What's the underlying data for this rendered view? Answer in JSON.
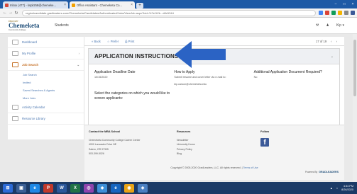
{
  "browser": {
    "tabs": [
      {
        "label": "Inbox (477) - kspitz58@chemeke...",
        "favicon_color": "#d44638"
      },
      {
        "label": "Office Assistant - Chemeketa Co...",
        "favicon_color": "#f2a100",
        "active": true
      }
    ],
    "new_tab": "+",
    "url": "regionlcandidate.gradleaders.com/Chemeketa/Candidates/Authenticated/Jobs/ViewJob.aspx?bid=%7e%2b...d8d1344",
    "extension_colors": [
      "#4285f4",
      "#db4437",
      "#0f9d58",
      "#f4b400",
      "#888888",
      "#3b5998"
    ]
  },
  "header": {
    "logo_discover": "Discover",
    "logo_brand": "Chemeketa",
    "logo_sub": "Community College",
    "app_name": "Students",
    "user_label": "Kip"
  },
  "sidebar": {
    "items": [
      {
        "label": "Dashboard"
      },
      {
        "label": "My Profile",
        "chevron": "›"
      },
      {
        "label": "Job Search",
        "chevron": "⌄",
        "active": true
      },
      {
        "label": "Activity Calendar"
      },
      {
        "label": "Resource Library"
      }
    ],
    "subitems": [
      "Job Search",
      "Invited",
      "Saved Searches & Agents",
      "More Jobs"
    ]
  },
  "toolbar": {
    "back": "« Back",
    "prefer": "☆ Prefer",
    "print": "⎙ Print",
    "pager": "17 of 19"
  },
  "panel": {
    "title": "APPLICATION INSTRUCTIONS",
    "col1_head": "Application Deadline Date",
    "col1_val": "10/15/2020",
    "col2_head": "How to Apply",
    "col2_val": "Submit resume and cover letter via e-mail to:",
    "col2_email": "kip.carson@chemeketa.edu",
    "col3_head": "Additional Application Document Required?",
    "col3_val": "No",
    "screen_label": "Select the categories on which you would like to screen applicants:"
  },
  "footer": {
    "contact_head": "Contact the MBA School",
    "contact_lines": [
      "Chemeketa Community College Career Center",
      "4000 Lancaster Drive NE",
      "Salem, OR 97305",
      "503-399-5026"
    ],
    "resources_head": "Resources",
    "resources_lines": [
      "Newsletter",
      "University Home",
      "Privacy Policy",
      "Blog"
    ],
    "follow_head": "Follow",
    "facebook": "f",
    "copyright": "Copyright © 2005-2020 GradLeaders, LLC. All rights reserved. |",
    "terms": "Terms of Use",
    "powered_by": "Powered By",
    "powered_brand": "GRADLEADERS"
  },
  "taskbar": {
    "apps": [
      {
        "label": "⊞",
        "color": "#2d6bd6"
      },
      {
        "label": "▣",
        "color": "#3a5f95"
      },
      {
        "label": "e",
        "color": "#1e88e5"
      },
      {
        "label": "P",
        "color": "#c0392b"
      },
      {
        "label": "W",
        "color": "#2b579a"
      },
      {
        "label": "X",
        "color": "#217346"
      },
      {
        "label": "◎",
        "color": "#8e44ad"
      },
      {
        "label": "◆",
        "color": "#3d8fd8"
      },
      {
        "label": "e",
        "color": "#1565c0"
      },
      {
        "label": "◉",
        "color": "#e8a317"
      },
      {
        "label": "◈",
        "color": "#4a7fc1"
      }
    ],
    "time": "4:34 PM",
    "date": "8/26/2020"
  },
  "colors": {
    "arrow": "#2b63c4",
    "link": "#4a76b0",
    "accent": "#c7732b"
  }
}
